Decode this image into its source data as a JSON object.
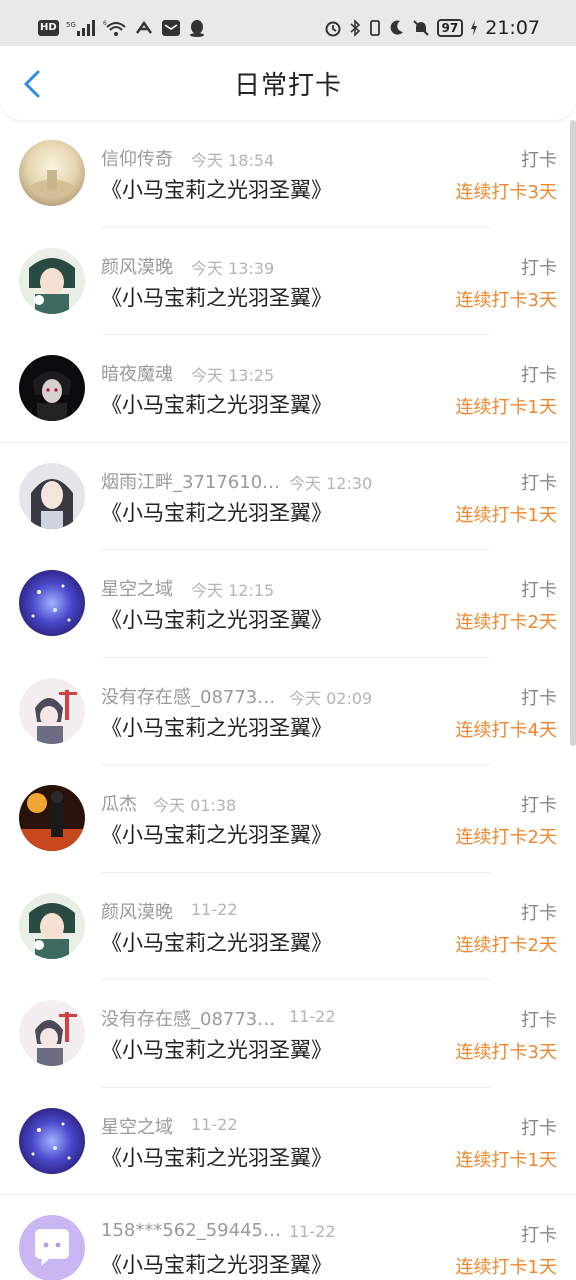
{
  "status_bar": {
    "left_icons": [
      "hd-icon",
      "signal-5g-icon",
      "signal-bars-icon",
      "wifi-icon",
      "app-icon",
      "mail-icon",
      "qq-icon"
    ],
    "hd": "HD",
    "battery": "97",
    "time": "21:07"
  },
  "header": {
    "title": "日常打卡",
    "back_icon": "chevron-left-icon"
  },
  "colors": {
    "accent": "#2f8be6",
    "streak": "#f0872e",
    "muted": "#9a9a9a"
  },
  "rows": [
    {
      "user": "信仰传奇",
      "time": "今天 18:54",
      "work": "《小马宝莉之光羽圣翼》",
      "action": "打卡",
      "streak": "连续打卡3天"
    },
    {
      "user": "颜风漠晚",
      "time": "今天 13:39",
      "work": "《小马宝莉之光羽圣翼》",
      "action": "打卡",
      "streak": "连续打卡3天"
    },
    {
      "user": "暗夜魔魂",
      "time": "今天 13:25",
      "work": "《小马宝莉之光羽圣翼》",
      "action": "打卡",
      "streak": "连续打卡1天"
    },
    {
      "user": "烟雨江畔_3717610…",
      "time": "今天 12:30",
      "work": "《小马宝莉之光羽圣翼》",
      "action": "打卡",
      "streak": "连续打卡1天"
    },
    {
      "user": "星空之域",
      "time": "今天 12:15",
      "work": "《小马宝莉之光羽圣翼》",
      "action": "打卡",
      "streak": "连续打卡2天"
    },
    {
      "user": "没有存在感_08773…",
      "time": "今天 02:09",
      "work": "《小马宝莉之光羽圣翼》",
      "action": "打卡",
      "streak": "连续打卡4天"
    },
    {
      "user": "瓜杰",
      "time": "今天 01:38",
      "work": "《小马宝莉之光羽圣翼》",
      "action": "打卡",
      "streak": "连续打卡2天"
    },
    {
      "user": "颜风漠晚",
      "time": "11-22",
      "work": "《小马宝莉之光羽圣翼》",
      "action": "打卡",
      "streak": "连续打卡2天"
    },
    {
      "user": "没有存在感_08773…",
      "time": "11-22",
      "work": "《小马宝莉之光羽圣翼》",
      "action": "打卡",
      "streak": "连续打卡3天"
    },
    {
      "user": "星空之域",
      "time": "11-22",
      "work": "《小马宝莉之光羽圣翼》",
      "action": "打卡",
      "streak": "连续打卡1天"
    },
    {
      "user": "158***562_59445…",
      "time": "11-22",
      "work": "《小马宝莉之光羽圣翼》",
      "action": "打卡",
      "streak": "连续打卡1天"
    }
  ]
}
